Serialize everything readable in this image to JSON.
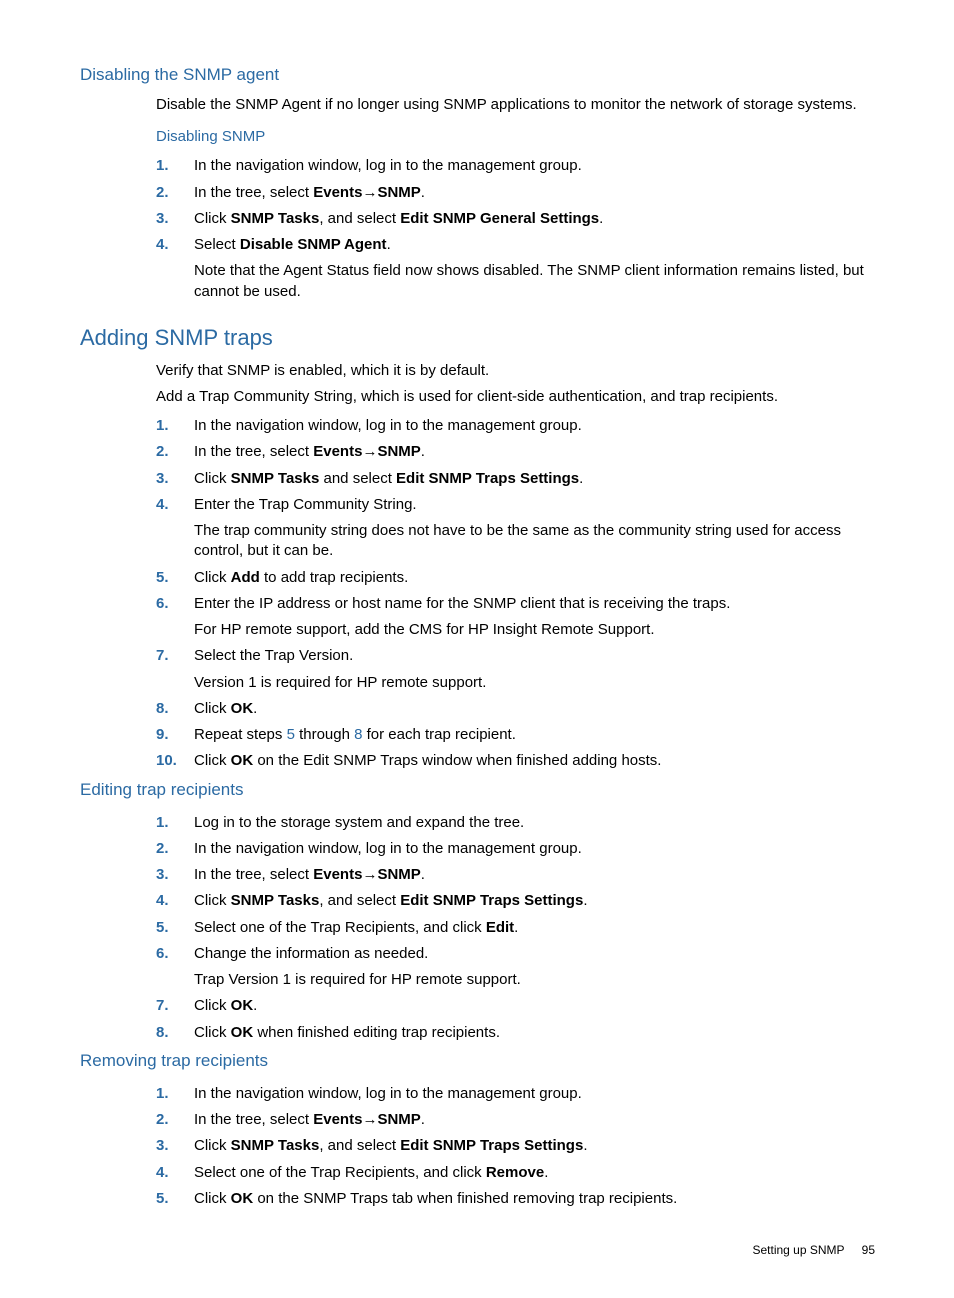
{
  "s1": {
    "title": "Disabling the SNMP agent",
    "p1": "Disable the SNMP Agent if no longer using SNMP applications to monitor the network of storage systems.",
    "sub_title": "Disabling SNMP",
    "steps": {
      "1": "In the navigation window, log in to the management group.",
      "2a": "In the tree, select ",
      "2b": "Events",
      "2c": "SNMP",
      "3a": "Click ",
      "3b": "SNMP Tasks",
      "3c": ", and select ",
      "3d": "Edit SNMP General Settings",
      "4a": "Select ",
      "4b": "Disable SNMP Agent",
      "4_sub": "Note that the Agent Status field now shows disabled. The SNMP client information remains listed, but cannot be used."
    }
  },
  "s2": {
    "title": "Adding SNMP traps",
    "p1": "Verify that SNMP is enabled, which it is by default.",
    "p2": "Add a Trap Community String, which is used for client-side authentication, and trap recipients.",
    "steps": {
      "1": "In the navigation window, log in to the management group.",
      "2a": "In the tree, select ",
      "2b": "Events",
      "2c": "SNMP",
      "3a": "Click ",
      "3b": "SNMP Tasks",
      "3c": " and select ",
      "3d": "Edit SNMP Traps Settings",
      "4": "Enter the Trap Community String.",
      "4_sub": "The trap community string does not have to be the same as the community string used for access control, but it can be.",
      "5a": "Click ",
      "5b": "Add",
      "5c": " to add trap recipients.",
      "6": "Enter the IP address or host name for the SNMP client that is receiving the traps.",
      "6_sub": "For HP remote support, add the CMS for HP Insight Remote Support.",
      "7": "Select the Trap Version.",
      "7_sub": "Version 1 is required for HP remote support.",
      "8a": "Click ",
      "8b": "OK",
      "9a": "Repeat steps ",
      "9b": "5",
      "9c": " through ",
      "9d": "8",
      "9e": " for each trap recipient.",
      "10a": "Click ",
      "10b": "OK",
      "10c": " on the Edit SNMP Traps window when finished adding hosts."
    }
  },
  "s3": {
    "title": "Editing trap recipients",
    "steps": {
      "1": "Log in to the storage system and expand the tree.",
      "2": "In the navigation window, log in to the management group.",
      "3a": "In the tree, select ",
      "3b": "Events",
      "3c": "SNMP",
      "4a": "Click ",
      "4b": "SNMP Tasks",
      "4c": ", and select ",
      "4d": "Edit SNMP Traps Settings",
      "5a": "Select one of the Trap Recipients, and click ",
      "5b": "Edit",
      "6": "Change the information as needed.",
      "6_sub": "Trap Version 1 is required for HP remote support.",
      "7a": "Click ",
      "7b": "OK",
      "8a": "Click ",
      "8b": "OK",
      "8c": " when finished editing trap recipients."
    }
  },
  "s4": {
    "title": "Removing trap recipients",
    "steps": {
      "1": "In the navigation window, log in to the management group.",
      "2a": "In the tree, select ",
      "2b": "Events",
      "2c": "SNMP",
      "3a": "Click ",
      "3b": "SNMP Tasks",
      "3c": ", and select ",
      "3d": "Edit SNMP Traps Settings",
      "4a": "Select one of the Trap Recipients, and click ",
      "4b": "Remove",
      "5a": "Click ",
      "5b": "OK",
      "5c": " on the SNMP Traps tab when finished removing trap recipients."
    }
  },
  "footer": {
    "section": "Setting up SNMP",
    "page": "95"
  }
}
